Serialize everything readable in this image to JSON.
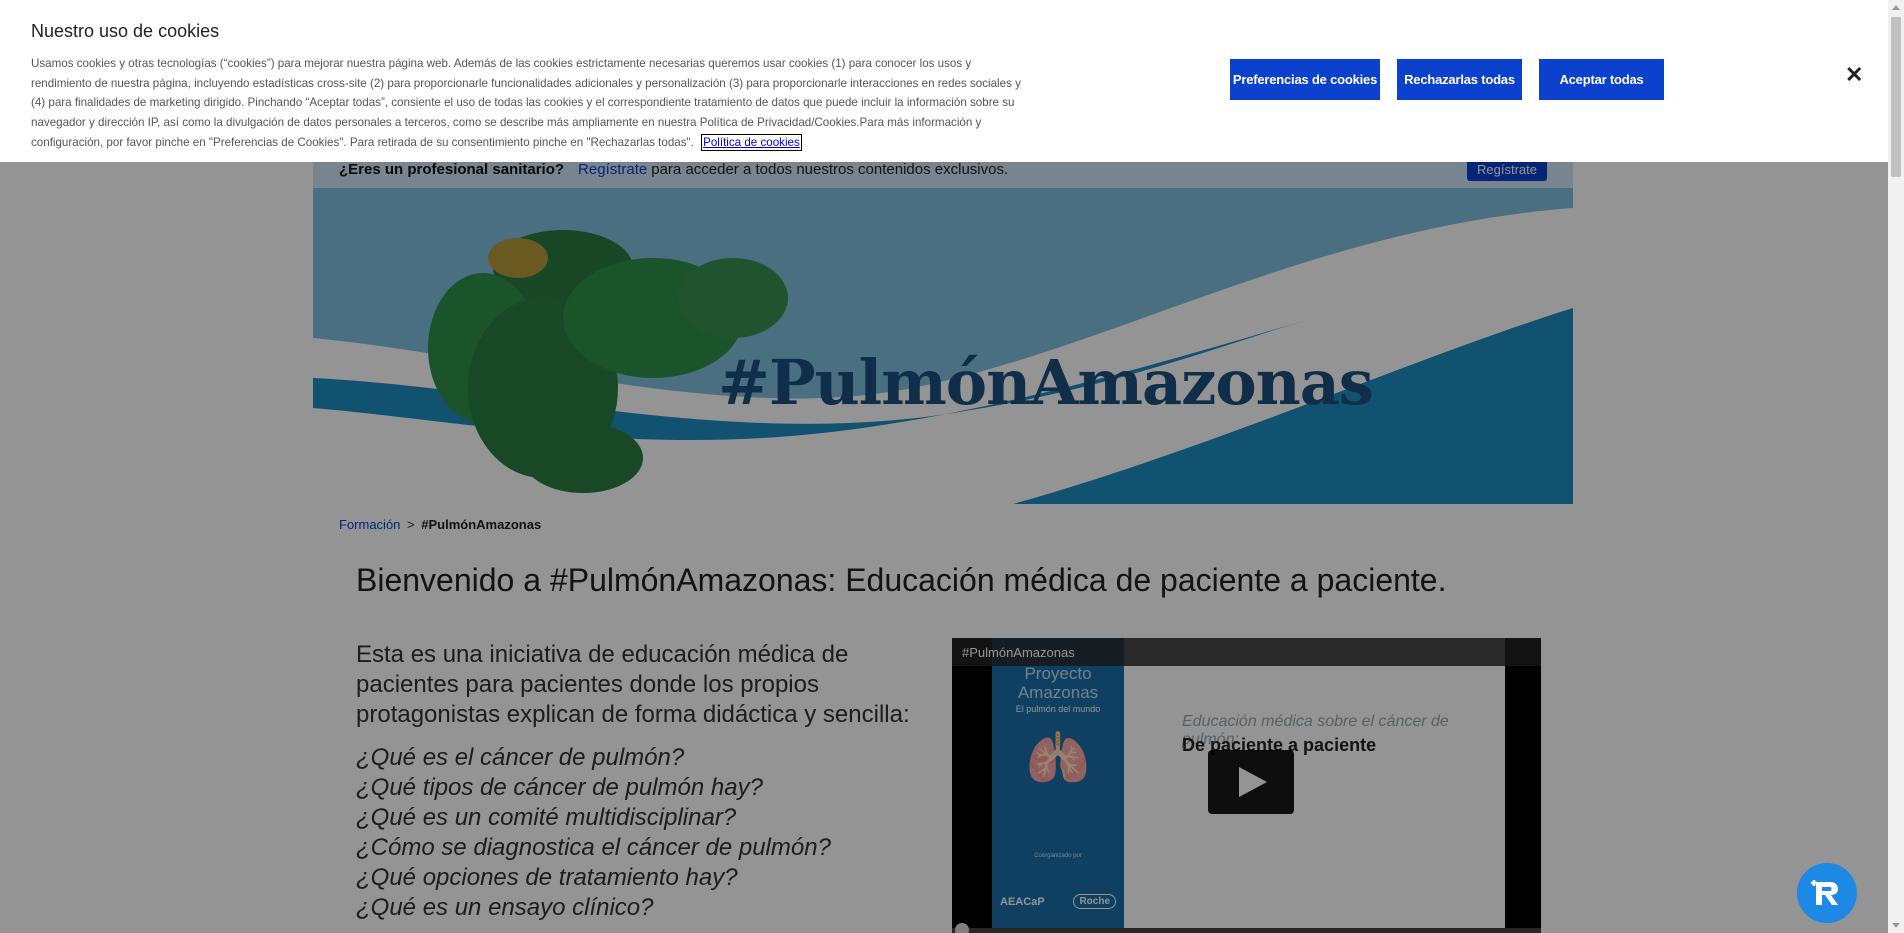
{
  "cookie_banner": {
    "title": "Nuestro uso de cookies",
    "text": "Usamos cookies y otras tecnologías (“cookies”) para mejorar nuestra página web. Además de las cookies estrictamente necesarias queremos usar cookies (1) para conocer los usos y rendimiento de nuestra página, incluyendo estadísticas cross-site (2) para proporcionarle funcionalidades adicionales y personalización (3) para proporcionarle interacciones en redes sociales y (4) para finalidades de marketing dirigido. Pinchando “Aceptar todas”, consiente el uso de todas las cookies y el correspondiente tratamiento de datos que puede incluir la información sobre su navegador y dirección IP, así como la divulgación de datos personales a terceros, como se describe más ampliamente en nuestra Política de Privacidad/Cookies.Para más información y configuración, por favor pinche en \"Preferencias de Cookies\". Para retirada de su consentimiento pinche en \"Rechazarlas todas\".",
    "policy_link": "Política de cookies",
    "prefs_label": "Preferencias de cookies",
    "reject_label": "Rechazarlas todas",
    "accept_label": "Aceptar todas",
    "close_glyph": "✕"
  },
  "hcp_bar": {
    "question": "¿Eres un profesional sanitario?",
    "link": "Regístrate",
    "rest": "para acceder a todos nuestros contenidos exclusivos.",
    "button": "Regístrate"
  },
  "hero": {
    "title": "#PulmónAmazonas"
  },
  "breadcrumb": {
    "link": "Formación",
    "separator": ">",
    "current": "#PulmónAmazonas"
  },
  "main": {
    "title": "Bienvenido a #PulmónAmazonas: Educación médica de paciente a paciente.",
    "intro": "Esta es una iniciativa de educación médica de pacientes para pacientes donde los propios protagonistas explican de forma didáctica y sencilla:",
    "questions": [
      "¿Qué es el cáncer de pulmón?",
      "¿Qué tipos de cáncer de pulmón hay?",
      "¿Qué es un comité multidisciplinar?",
      "¿Cómo se diagnostica el cáncer de pulmón?",
      "¿Qué opciones de tratamiento hay?",
      "¿Qué es un ensayo clínico?"
    ]
  },
  "video": {
    "title": "#PulmónAmazonas",
    "proyecto": "Proyecto Amazonas",
    "proyecto_sub": "El pulmón del mundo",
    "organizado": "Coorganizado por",
    "logo1": "AEACaP",
    "logo2": "Roche",
    "subtitle": "Educación médica sobre el cáncer de pulmón:",
    "headline": "De paciente a paciente"
  },
  "icons": {
    "close": "close-icon",
    "play": "play-icon",
    "chat": "chat-assistant-icon",
    "lungs": "lungs-icon"
  },
  "colors": {
    "brand_blue": "#0b41cd",
    "hero_blue": "#1d4e7e",
    "hcp_bar_bg": "#cfe6f5",
    "fab_blue": "#1e88e5"
  }
}
